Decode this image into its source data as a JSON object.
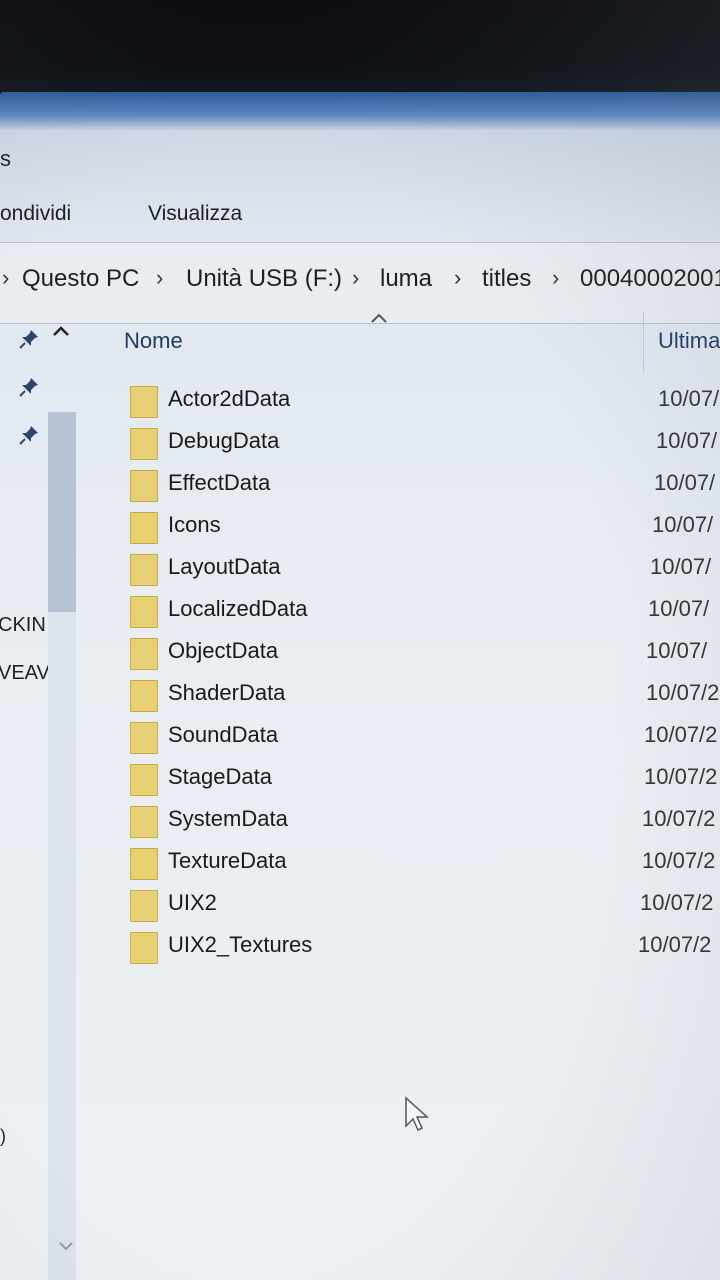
{
  "window": {
    "title": "s"
  },
  "ribbon": {
    "tabs": [
      {
        "label": "ondividi"
      },
      {
        "label": "Visualizza"
      }
    ]
  },
  "breadcrumb": {
    "items": [
      "Questo PC",
      "Unità USB (F:)",
      "luma",
      "titles",
      "00040002001"
    ],
    "separator": "›"
  },
  "nav_pane": {
    "labels": [
      "CKIN",
      "VEAV"
    ]
  },
  "columns": {
    "name": "Nome",
    "modified": "Ultima"
  },
  "folders": [
    {
      "name": "Actor2dData",
      "date": "10/07/"
    },
    {
      "name": "DebugData",
      "date": "10/07/"
    },
    {
      "name": "EffectData",
      "date": "10/07/"
    },
    {
      "name": "Icons",
      "date": "10/07/"
    },
    {
      "name": "LayoutData",
      "date": "10/07/"
    },
    {
      "name": "LocalizedData",
      "date": "10/07/"
    },
    {
      "name": "ObjectData",
      "date": "10/07/"
    },
    {
      "name": "ShaderData",
      "date": "10/07/2"
    },
    {
      "name": "SoundData",
      "date": "10/07/2"
    },
    {
      "name": "StageData",
      "date": "10/07/2"
    },
    {
      "name": "SystemData",
      "date": "10/07/2"
    },
    {
      "name": "TextureData",
      "date": "10/07/2"
    },
    {
      "name": "UIX2",
      "date": "10/07/2"
    },
    {
      "name": "UIX2_Textures",
      "date": "10/07/2"
    }
  ],
  "misc": {
    "left_paren": ")"
  },
  "colors": {
    "folder": "#e8cf74",
    "accent": "#1f3c66"
  }
}
